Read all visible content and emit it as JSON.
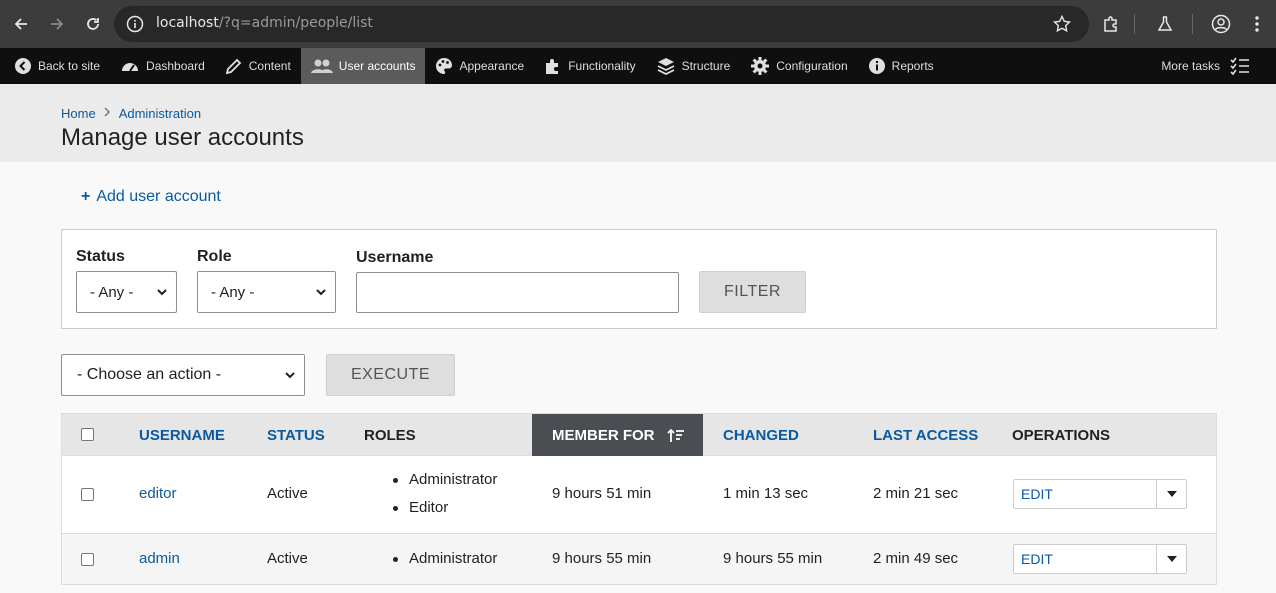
{
  "browser": {
    "url_host": "localhost",
    "url_path": "/?q=admin/people/list"
  },
  "toolbar": {
    "items": [
      {
        "label": "Back to site",
        "icon": "back-circle-icon"
      },
      {
        "label": "Dashboard",
        "icon": "dashboard-gauge-icon"
      },
      {
        "label": "Content",
        "icon": "pencil-icon"
      },
      {
        "label": "User accounts",
        "icon": "users-icon",
        "active": true
      },
      {
        "label": "Appearance",
        "icon": "palette-icon"
      },
      {
        "label": "Functionality",
        "icon": "puzzle-icon"
      },
      {
        "label": "Structure",
        "icon": "layers-icon"
      },
      {
        "label": "Configuration",
        "icon": "gear-icon"
      },
      {
        "label": "Reports",
        "icon": "info-icon"
      }
    ],
    "more_tasks": "More tasks"
  },
  "breadcrumb": [
    "Home",
    "Administration"
  ],
  "page_title": "Manage user accounts",
  "add_link": "Add user account",
  "filters": {
    "status_label": "Status",
    "status_value": "- Any -",
    "role_label": "Role",
    "role_value": "- Any -",
    "username_label": "Username",
    "username_value": "",
    "filter_button": "FILTER"
  },
  "bulk": {
    "action_value": "- Choose an action -",
    "execute_button": "EXECUTE"
  },
  "table": {
    "headers": {
      "username": "USERNAME",
      "status": "STATUS",
      "roles": "ROLES",
      "member_for": "MEMBER FOR",
      "changed": "CHANGED",
      "last_access": "LAST ACCESS",
      "operations": "OPERATIONS"
    },
    "rows": [
      {
        "username": "editor",
        "status": "Active",
        "roles": [
          "Administrator",
          "Editor"
        ],
        "member_for": "9 hours 51 min",
        "changed": "1 min 13 sec",
        "last_access": "2 min 21 sec",
        "operation": "EDIT"
      },
      {
        "username": "admin",
        "status": "Active",
        "roles": [
          "Administrator"
        ],
        "member_for": "9 hours 55 min",
        "changed": "9 hours 55 min",
        "last_access": "2 min 49 sec",
        "operation": "EDIT"
      }
    ]
  },
  "colors": {
    "link": "#0a5aa0",
    "toolbar_bg": "#0f0f0f",
    "toolbar_active": "#5b5b5b",
    "sorted_header": "#4a4d51"
  }
}
